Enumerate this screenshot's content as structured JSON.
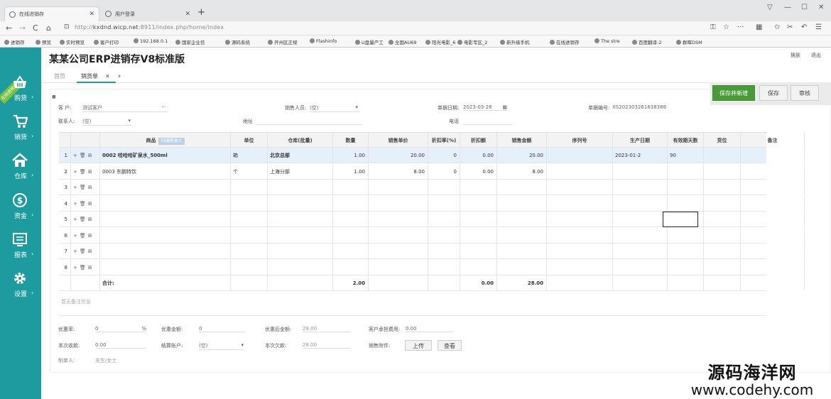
{
  "browser": {
    "tabs": [
      {
        "label": "在线进销存"
      },
      {
        "label": "用户登录"
      }
    ],
    "url_prefix": "http://",
    "url_host": "kxdnd.wicp.net",
    "url_rest": ":8911/index.php/home/index",
    "bookmarks": [
      "进销存",
      "预览",
      "实时预览",
      "客户打印",
      "192.168.0.1",
      "国家企业信",
      "源码系统",
      "开州区正规",
      "Flashinfo",
      "U盘量产工",
      "全国AU69",
      "阳光电影_6",
      "电影专区_2",
      "新升级手机",
      "在线进销存",
      "The stre",
      "百度翻译-2",
      "群晖DSM"
    ]
  },
  "app": {
    "title": "某某公司ERP进销存V8标准版",
    "top_links": [
      "换肤",
      "退出"
    ],
    "tabs": [
      "首页",
      "销货单"
    ],
    "ribbon": "在线进销存",
    "sidebar": [
      {
        "label": "购货",
        "icon": "basket-icon"
      },
      {
        "label": "销货",
        "icon": "cart-icon"
      },
      {
        "label": "仓库",
        "icon": "home-icon"
      },
      {
        "label": "资金",
        "icon": "dollar-icon"
      },
      {
        "label": "报表",
        "icon": "report-icon"
      },
      {
        "label": "设置",
        "icon": "gear-icon"
      }
    ]
  },
  "toolbar": {
    "save_new": "保存并新增",
    "save": "保存",
    "audit": "审核"
  },
  "form": {
    "customer_label": "客 户:",
    "customer_value": "测试客户",
    "sales_label": "销售人员:",
    "sales_value": "(空)",
    "date_label": "单据日期:",
    "date_value": "2023-03-26",
    "no_label": "单据编号:",
    "no_value": "XS202303261638388",
    "contact_label": "联系人:",
    "contact_value": "(空)",
    "address_label": "地址",
    "phone_label": "电话"
  },
  "grid": {
    "scan_label": "扫描枪录入",
    "headers": [
      "商品",
      "单位",
      "仓库(批量)",
      "数量",
      "销售单价",
      "折扣率(%)",
      "折扣额",
      "销售金额",
      "序列号",
      "生产日期",
      "有效期天数",
      "货位",
      "备注"
    ],
    "rows": [
      {
        "n": "1",
        "product": "0002 哇哈哈矿泉水_500ml",
        "unit": "箱",
        "wh": "北京总部",
        "qty": "1.00",
        "price": "20.00",
        "rate": "0",
        "disc": "0.00",
        "amount": "20.00",
        "serial": "",
        "mfg": "2023-01-2",
        "days": "90",
        "loc": "",
        "note": ""
      },
      {
        "n": "2",
        "product": "0003 东鹏特饮",
        "unit": "个",
        "wh": "上海分部",
        "qty": "1.00",
        "price": "8.00",
        "rate": "0",
        "disc": "0.00",
        "amount": "8.00",
        "serial": "",
        "mfg": "",
        "days": "",
        "loc": "",
        "note": ""
      },
      {
        "n": "3"
      },
      {
        "n": "4"
      },
      {
        "n": "5"
      },
      {
        "n": "6"
      },
      {
        "n": "7"
      },
      {
        "n": "8"
      }
    ],
    "total_label": "合计:",
    "total_qty": "2.00",
    "total_disc": "0.00",
    "total_amount": "28.00"
  },
  "note_placeholder": "暂无备注信息",
  "footer": {
    "rate_label": "优惠率:",
    "rate_value": "0",
    "rate_unit": "%",
    "disc_label": "优惠金额:",
    "disc_value": "0",
    "after_label": "优惠后金额:",
    "after_value": "28.00",
    "fee_label": "客户承担费用:",
    "fee_value": "0.00",
    "recv_label": "本次收款:",
    "recv_value": "0.00",
    "acct_label": "结算账户:",
    "acct_value": "(空)",
    "debt_label": "本次欠款:",
    "debt_value": "28.00",
    "attach_label": "销售附件:",
    "upload": "上传",
    "view": "查看",
    "maker_label": "制单人:",
    "maker_value": "先生/女士"
  },
  "watermark": {
    "line1": "源码海洋网",
    "line2": "www.codehy.com"
  },
  "colors": {
    "sidebar": "#1e9b9f",
    "accent_green": "#4a9a3b",
    "ribbon": "#7bc142"
  }
}
